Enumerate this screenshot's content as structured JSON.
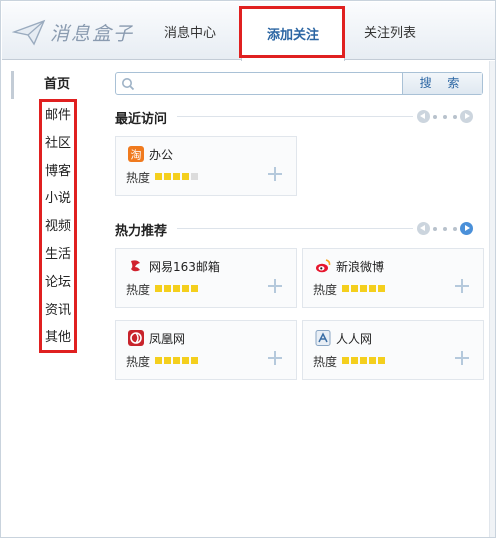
{
  "app": {
    "logo_text": "消息盒子"
  },
  "tabs": {
    "message_center": "消息中心",
    "add_follow": "添加关注",
    "follow_list": "关注列表"
  },
  "sidebar": {
    "home": "首页",
    "items": [
      "邮件",
      "社区",
      "博客",
      "小说",
      "视频",
      "生活",
      "论坛",
      "资讯",
      "其他"
    ]
  },
  "search": {
    "placeholder": "",
    "value": "",
    "button_label": "搜 索"
  },
  "recent": {
    "title": "最近访问",
    "cards": [
      {
        "name": "办公",
        "heat_label": "热度",
        "heat": 4,
        "heat_max": 5,
        "icon": "taobao-icon"
      }
    ]
  },
  "hot": {
    "title": "热力推荐",
    "cards": [
      {
        "name": "网易163邮箱",
        "heat_label": "热度",
        "heat": 5,
        "heat_max": 5,
        "icon": "netease-icon"
      },
      {
        "name": "新浪微博",
        "heat_label": "热度",
        "heat": 5,
        "heat_max": 5,
        "icon": "weibo-icon"
      },
      {
        "name": "凤凰网",
        "heat_label": "热度",
        "heat": 5,
        "heat_max": 5,
        "icon": "ifeng-icon"
      },
      {
        "name": "人人网",
        "heat_label": "热度",
        "heat": 5,
        "heat_max": 5,
        "icon": "renren-icon"
      }
    ]
  },
  "colors": {
    "accent": "#2c66a3",
    "highlight": "#e02020",
    "star_on": "#f4cf1d",
    "star_off": "#dcdcdc"
  }
}
